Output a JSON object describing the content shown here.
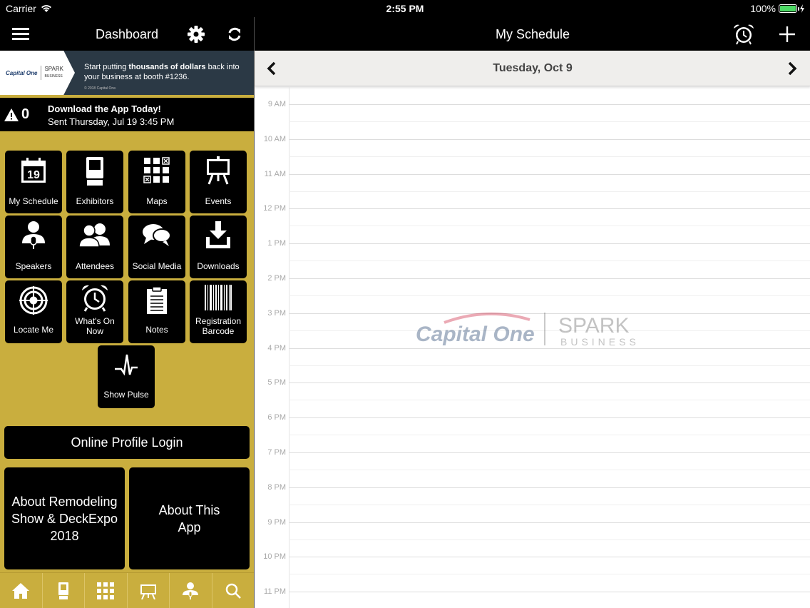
{
  "status_bar": {
    "carrier": "Carrier",
    "time": "2:55 PM",
    "battery": "100%"
  },
  "left_nav": {
    "title": "Dashboard"
  },
  "banner": {
    "logo_company": "Capital One",
    "logo_product": "SPARK",
    "logo_product_sub": "BUSINESS",
    "text_pre": "Start putting ",
    "text_bold": "thousands of dollars",
    "text_post": " back into your business at booth #1236.",
    "fineprint": "© 2018 Capital One."
  },
  "alert": {
    "count": "0",
    "title": "Download the App Today!",
    "subtitle": "Sent Thursday, Jul 19 3:45 PM"
  },
  "calendar_icon_day": "19",
  "tiles": [
    {
      "label": "My Schedule",
      "icon": "calendar-icon"
    },
    {
      "label": "Exhibitors",
      "icon": "booth-icon"
    },
    {
      "label": "Maps",
      "icon": "map-grid-icon"
    },
    {
      "label": "Events",
      "icon": "easel-icon"
    },
    {
      "label": "Speakers",
      "icon": "speaker-icon"
    },
    {
      "label": "Attendees",
      "icon": "attendees-icon"
    },
    {
      "label": "Social Media",
      "icon": "chat-bubbles-icon"
    },
    {
      "label": "Downloads",
      "icon": "download-icon"
    },
    {
      "label": "Locate Me",
      "icon": "target-icon"
    },
    {
      "label": "What's On Now",
      "icon": "alarm-clock-icon"
    },
    {
      "label": "Notes",
      "icon": "notes-icon"
    },
    {
      "label": "Registration Barcode",
      "icon": "barcode-icon"
    },
    {
      "label": "Show Pulse",
      "icon": "pulse-icon"
    }
  ],
  "buttons": {
    "online_profile_login": "Online Profile Login",
    "about_show": "About Remodeling Show & DeckExpo 2018",
    "about_app": "About This App"
  },
  "tabbar": [
    "home-icon",
    "booth-icon",
    "map-grid-icon",
    "easel-icon",
    "speaker-icon",
    "search-icon"
  ],
  "right_nav": {
    "title": "My Schedule"
  },
  "datebar": {
    "date": "Tuesday, Oct 9"
  },
  "hours": [
    "9 AM",
    "10 AM",
    "11 AM",
    "12 PM",
    "1 PM",
    "2 PM",
    "3 PM",
    "4 PM",
    "5 PM",
    "6 PM",
    "7 PM",
    "8 PM",
    "9 PM",
    "10 PM",
    "11 PM"
  ],
  "watermark": {
    "company": "Capital One",
    "product": "SPARK",
    "product_sub": "BUSINESS"
  },
  "colors": {
    "left_bg": "#c9ae3e",
    "nav_bg": "#000000",
    "tile_bg": "#000000",
    "battery": "#4cd964"
  }
}
